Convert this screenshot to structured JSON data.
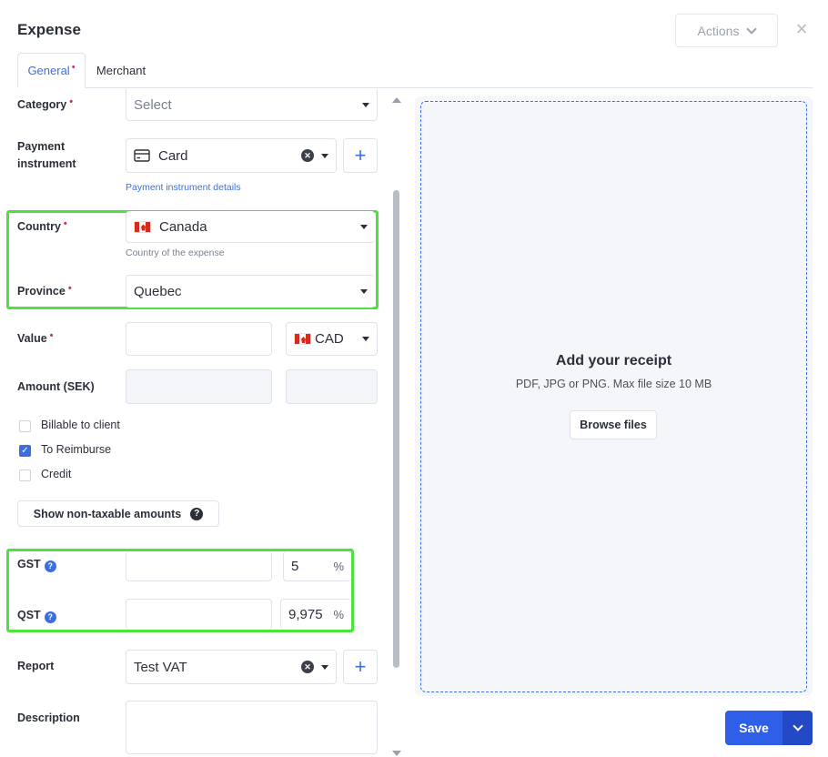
{
  "header": {
    "title": "Expense",
    "actions_label": "Actions"
  },
  "tabs": [
    {
      "label": "General",
      "required": true,
      "active": true
    },
    {
      "label": "Merchant",
      "required": false,
      "active": false
    }
  ],
  "form": {
    "category": {
      "label": "Category",
      "placeholder": "Select"
    },
    "payment_instrument": {
      "label_line1": "Payment",
      "label_line2": "instrument",
      "value": "Card",
      "details_link": "Payment instrument details"
    },
    "country": {
      "label": "Country",
      "value": "Canada",
      "hint": "Country of the expense"
    },
    "province": {
      "label": "Province",
      "value": "Quebec"
    },
    "value": {
      "label": "Value",
      "amount": "",
      "currency": "CAD"
    },
    "amount_sek": {
      "label": "Amount (SEK)"
    },
    "checkboxes": [
      {
        "label": "Billable to client",
        "checked": false
      },
      {
        "label": "To Reimburse",
        "checked": true
      },
      {
        "label": "Credit",
        "checked": false
      }
    ],
    "non_taxable_button": "Show non-taxable amounts",
    "gst": {
      "label": "GST",
      "amount": "",
      "rate": "5",
      "unit": "%"
    },
    "qst": {
      "label": "QST",
      "amount": "",
      "rate": "9,975",
      "unit": "%"
    },
    "report": {
      "label": "Report",
      "value": "Test VAT"
    },
    "description": {
      "label": "Description",
      "value": ""
    }
  },
  "receipt": {
    "title": "Add your receipt",
    "subtitle": "PDF, JPG or PNG. Max file size 10 MB",
    "browse_label": "Browse files"
  },
  "footer": {
    "save_label": "Save"
  },
  "colors": {
    "accent": "#3b6fe0",
    "primary_button": "#2f5ee8",
    "highlight": "#4be33c",
    "required": "#d32f4a"
  }
}
